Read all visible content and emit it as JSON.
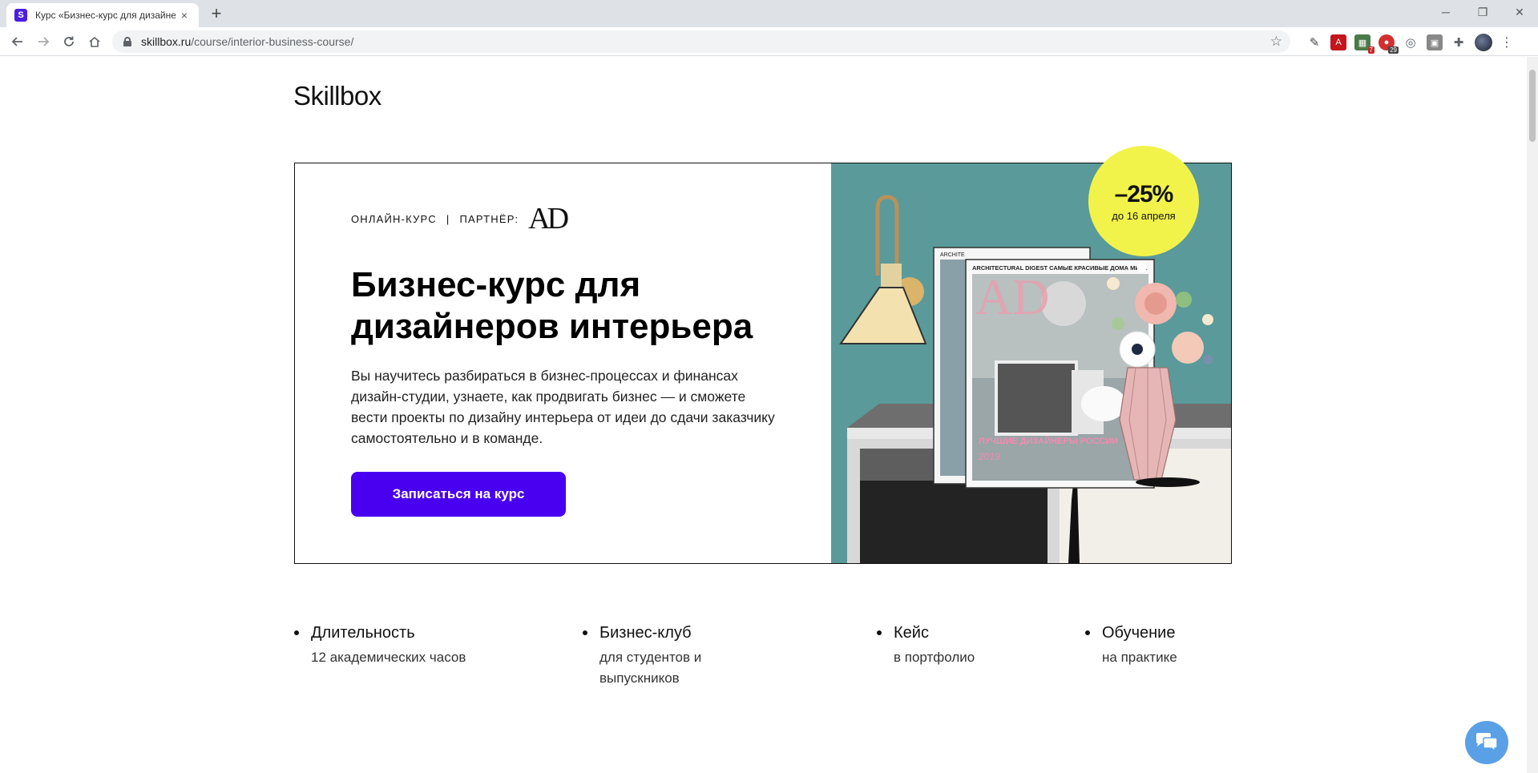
{
  "browser": {
    "tab_favicon": "S",
    "tab_title": "Курс «Бизнес-курс для дизайнеров интерьера»",
    "tab_close": "×",
    "new_tab": "+",
    "url_host": "skillbox.ru",
    "url_path": "/course/interior-business-course/",
    "ext_badge_1": "7",
    "ext_badge_2": "29",
    "icons": [
      "back-icon",
      "forward-icon",
      "reload-icon",
      "home-icon",
      "lock-icon",
      "star-icon",
      "puzzle-icon",
      "menu-icon"
    ]
  },
  "header": {
    "logo": "Skillbox"
  },
  "hero": {
    "eyebrow_type": "ОНЛАЙН-КУРС",
    "eyebrow_sep": "|",
    "eyebrow_partner": "ПАРТНЁР:",
    "partner_logo": "AD",
    "title": "Бизнес-курс для дизайнеров интерьера",
    "description": "Вы научитесь разбираться в бизнес-процессах и финансах дизайн-студии, узнаете, как продвигать бизнес — и сможете вести проекты по дизайну интерьера от идеи до сдачи заказчику самостоятельно и в команде.",
    "cta_label": "Записаться на курс",
    "discount_value": "–25%",
    "discount_until": "до 16 апреля",
    "magazine_header": "ARCHITECTURAL DIGEST САМЫЕ КРАСИВЫЕ ДОМА МИРА",
    "magazine_cover_text": "ЛУЧШИЕ ДИЗАЙНЕРЫ РОССИИ",
    "magazine_year": "2019",
    "magazine_back_logo": "ARCHITE"
  },
  "features": [
    {
      "title": "Длительность",
      "subtitle": "12 академических часов"
    },
    {
      "title": "Бизнес-клуб",
      "subtitle": "для студентов и выпускников"
    },
    {
      "title": "Кейс",
      "subtitle": "в портфолио"
    },
    {
      "title": "Обучение",
      "subtitle": "на практике"
    }
  ],
  "colors": {
    "brand_purple": "#4a00f0",
    "teal_bg": "#5a9a9a",
    "discount_yellow": "#f2f34a",
    "chat_blue": "#5aa0e6"
  }
}
